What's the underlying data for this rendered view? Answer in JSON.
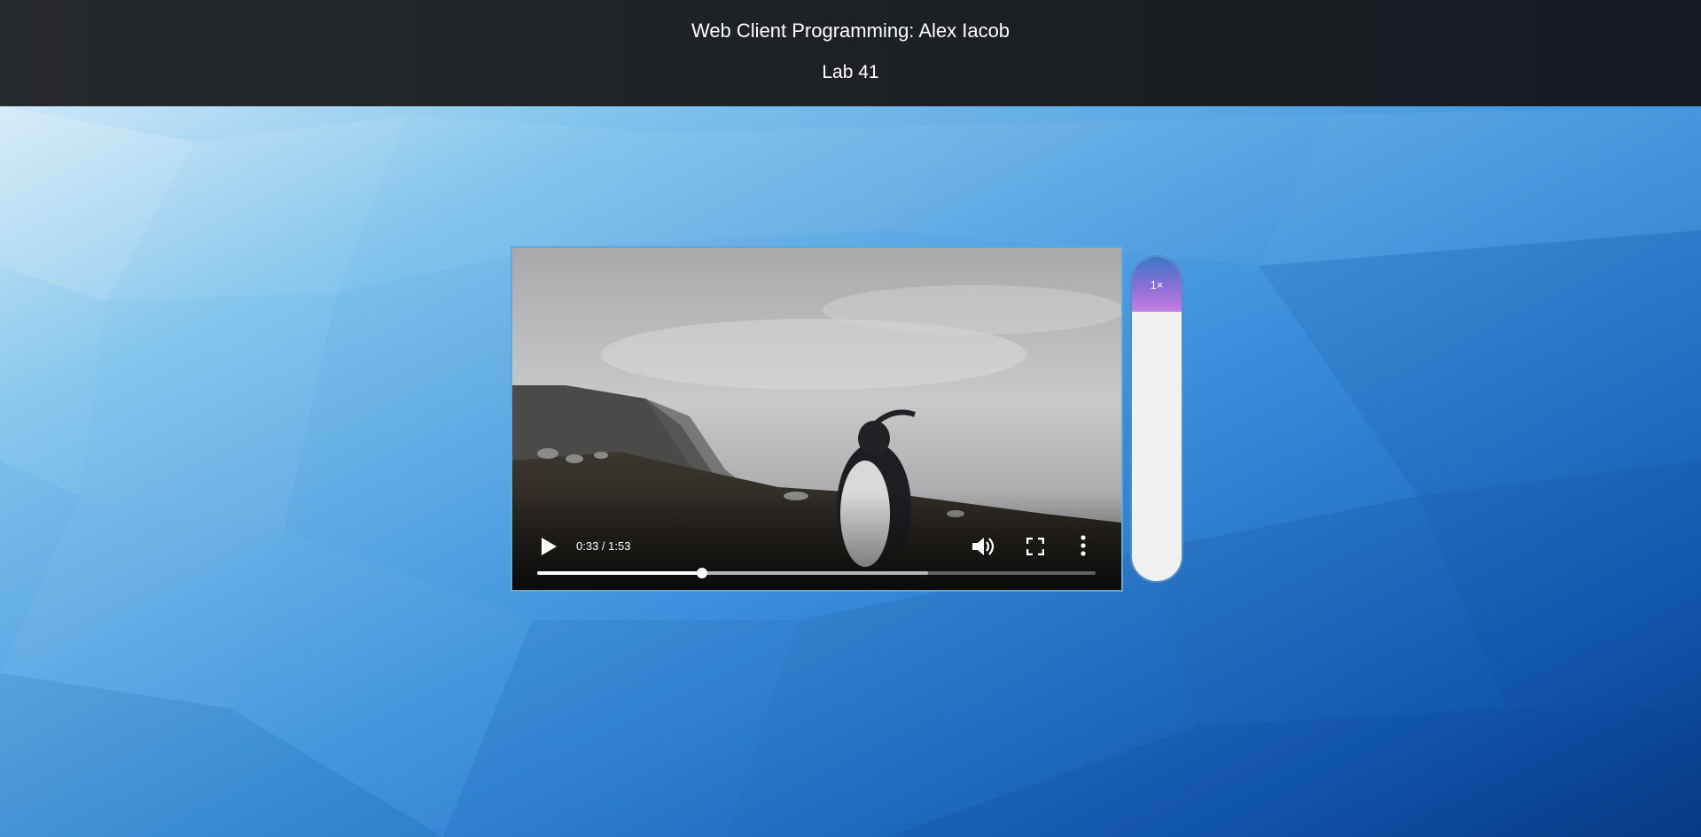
{
  "header": {
    "title": "Web Client Programming: Alex Iacob",
    "subtitle": "Lab 41"
  },
  "video": {
    "current_time": "0:33",
    "duration": "1:53",
    "time_display": "0:33 / 1:53",
    "progress_fraction": 0.295,
    "buffered_fraction": 0.7,
    "icons": {
      "play": "play-icon",
      "volume": "volume-icon",
      "fullscreen": "fullscreen-icon",
      "more": "more-options-icon"
    }
  },
  "speed_bar": {
    "label": "1×",
    "fill_fraction": 0.17,
    "colors": {
      "fill_top": "#3a78c8",
      "fill_bottom": "#c87ee0",
      "track": "#f1f1f1"
    }
  },
  "colors": {
    "header_bg": "#1d2125",
    "background_light": "#d7ecfa",
    "background_dark": "#0a4a9e"
  }
}
